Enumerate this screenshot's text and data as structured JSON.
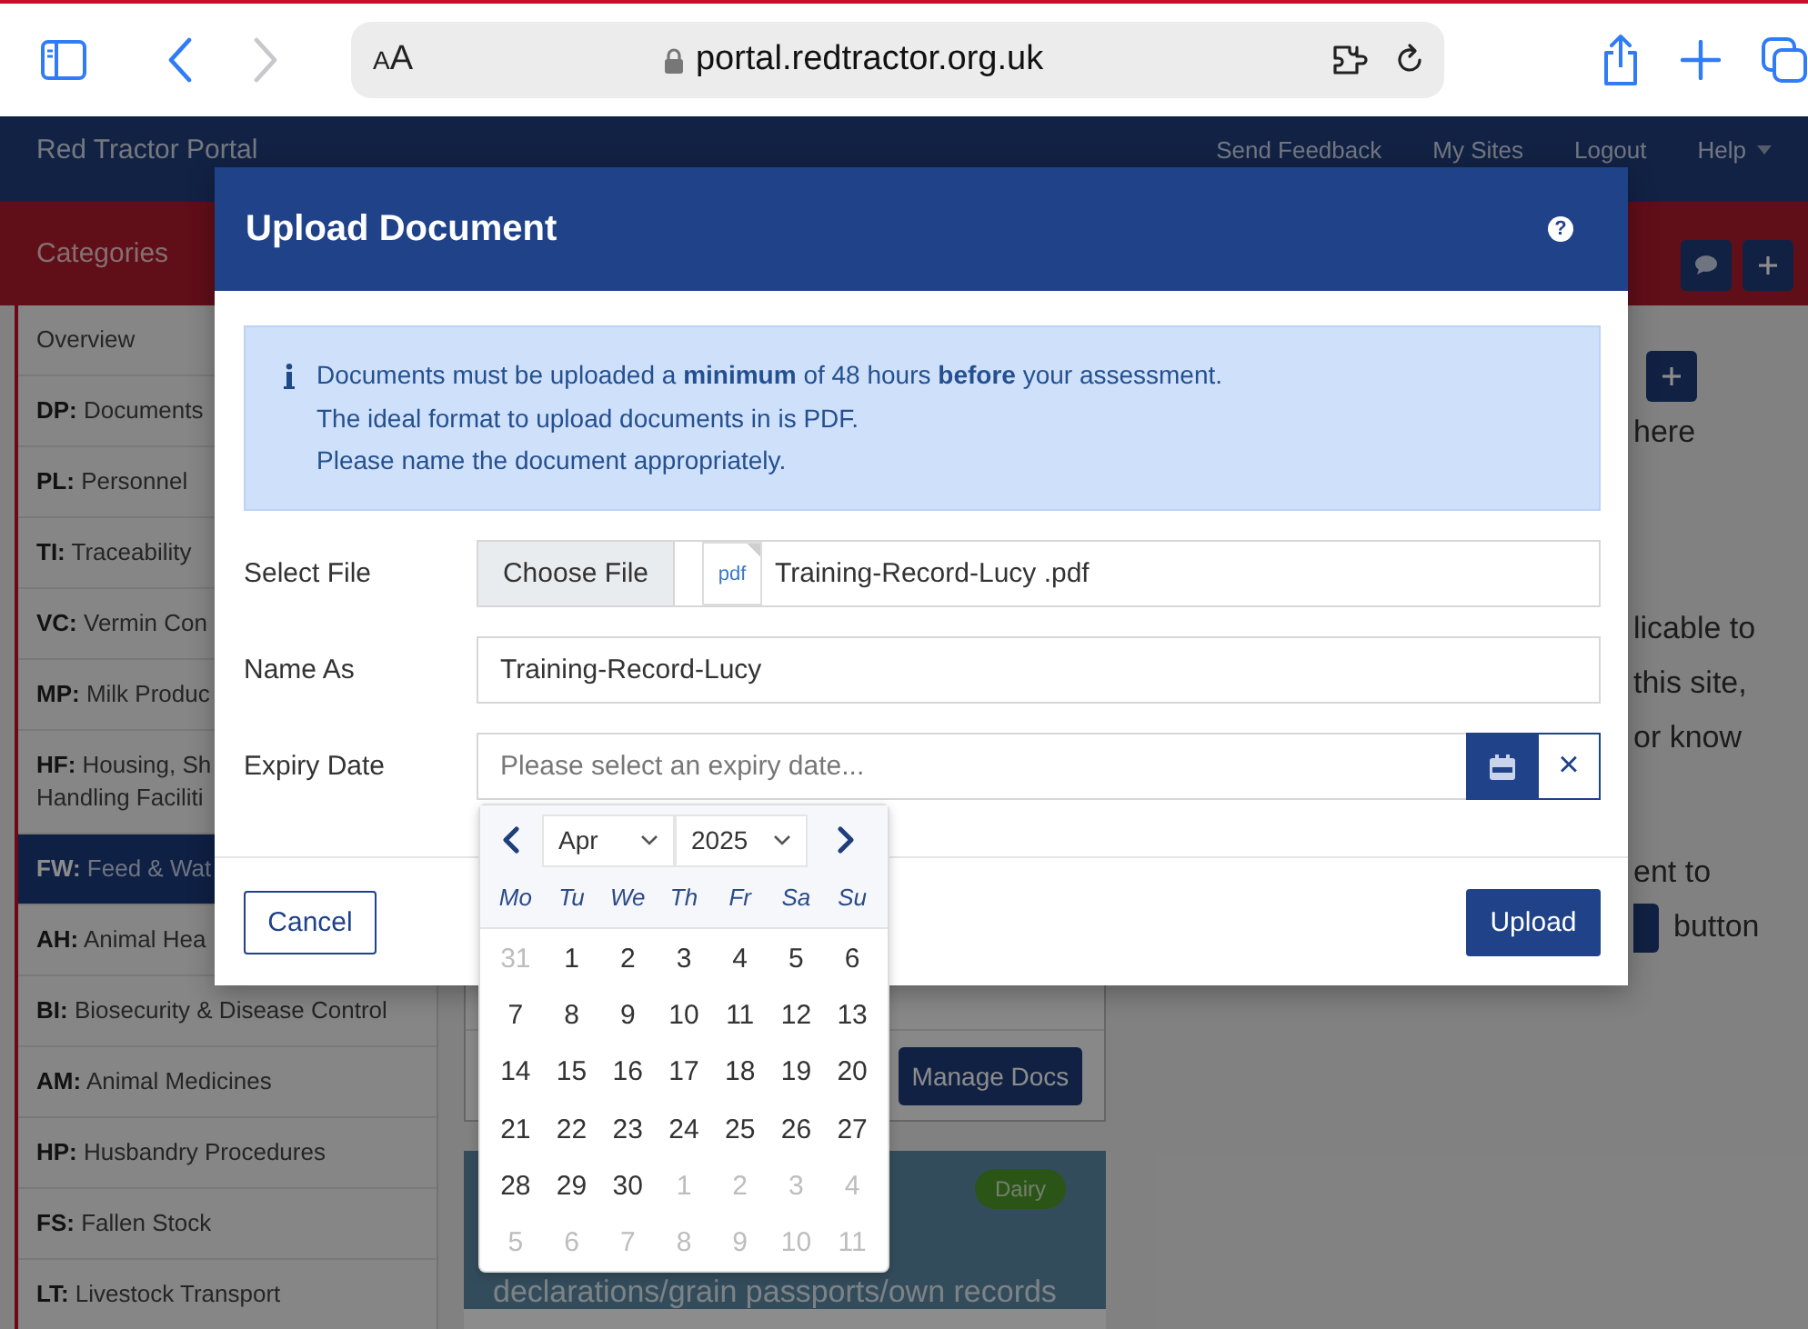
{
  "browser": {
    "text_size": "AA",
    "address": "portal.redtractor.org.uk",
    "back_disabled": false,
    "forward_disabled": true
  },
  "navbar": {
    "brand": "Red Tractor Portal",
    "links": [
      "Send Feedback",
      "My Sites",
      "Logout"
    ],
    "help": "Help"
  },
  "category_bar": {
    "title": "Categories"
  },
  "sidebar": {
    "items": [
      {
        "label": "Overview",
        "selected": false
      },
      {
        "label": "**DP:** Documents",
        "selected": false
      },
      {
        "label": "**PL:** Personnel",
        "selected": false
      },
      {
        "label": "**TI:** Traceability",
        "selected": false
      },
      {
        "label": "**VC:** Vermin Con",
        "selected": false
      },
      {
        "label": "**MP:** Milk Produc",
        "selected": false
      },
      {
        "label": "**HF:** Housing, Sh\nHandling Faciliti",
        "selected": false
      },
      {
        "label": "**FW:** Feed & Wat",
        "selected": true
      },
      {
        "label": "**AH:** Animal Hea",
        "selected": false
      },
      {
        "label": "**BI:** Biosecurity & Disease Control",
        "selected": false
      },
      {
        "label": "**AM:** Animal Medicines",
        "selected": false
      },
      {
        "label": "**HP:** Husbandry Procedures",
        "selected": false
      },
      {
        "label": "**FS:** Fallen Stock",
        "selected": false
      },
      {
        "label": "**LT:** Livestock Transport",
        "selected": false
      }
    ]
  },
  "background": {
    "right_top": "here",
    "right_middle": [
      "licable to",
      "this site,",
      "or know"
    ],
    "right_bottom": [
      "ent to",
      "button"
    ],
    "manage_button": "Manage Docs",
    "tag": "Dairy",
    "card_text": "declarations/grain passports/own records"
  },
  "modal": {
    "title": "Upload Document",
    "help": "?",
    "notice": [
      "Documents must be uploaded a **minimum** of 48 hours **before** your assessment.",
      "The ideal format to upload documents in is PDF.",
      "Please name the document appropriately."
    ],
    "fields": [
      {
        "kind": "file",
        "label": "Select File",
        "button": "Choose File",
        "file_type": "pdf",
        "value": "Training-Record-Lucy .pdf"
      },
      {
        "kind": "text",
        "label": "Name As",
        "value": "Training-Record-Lucy"
      },
      {
        "kind": "date",
        "label": "Expiry Date",
        "placeholder": "Please select an expiry date...",
        "clear": "×"
      }
    ],
    "cancel": "Cancel",
    "submit": "Upload"
  },
  "datepicker": {
    "month": "Apr",
    "year": "2025",
    "weekdays": [
      "Mo",
      "Tu",
      "We",
      "Th",
      "Fr",
      "Sa",
      "Su"
    ],
    "weeks": [
      [
        {
          "day": "31",
          "muted": true
        },
        {
          "day": "1",
          "muted": false
        },
        {
          "day": "2",
          "muted": false
        },
        {
          "day": "3",
          "muted": false
        },
        {
          "day": "4",
          "muted": false
        },
        {
          "day": "5",
          "muted": false
        },
        {
          "day": "6",
          "muted": false
        }
      ],
      [
        {
          "day": "7",
          "muted": false
        },
        {
          "day": "8",
          "muted": false
        },
        {
          "day": "9",
          "muted": false
        },
        {
          "day": "10",
          "muted": false
        },
        {
          "day": "11",
          "muted": false
        },
        {
          "day": "12",
          "muted": false
        },
        {
          "day": "13",
          "muted": false
        }
      ],
      [
        {
          "day": "14",
          "muted": false
        },
        {
          "day": "15",
          "muted": false
        },
        {
          "day": "16",
          "muted": false
        },
        {
          "day": "17",
          "muted": false
        },
        {
          "day": "18",
          "muted": false
        },
        {
          "day": "19",
          "muted": false
        },
        {
          "day": "20",
          "muted": false
        }
      ],
      [
        {
          "day": "21",
          "muted": false
        },
        {
          "day": "22",
          "muted": false
        },
        {
          "day": "23",
          "muted": false
        },
        {
          "day": "24",
          "muted": false
        },
        {
          "day": "25",
          "muted": false
        },
        {
          "day": "26",
          "muted": false
        },
        {
          "day": "27",
          "muted": false
        }
      ],
      [
        {
          "day": "28",
          "muted": false
        },
        {
          "day": "29",
          "muted": false
        },
        {
          "day": "30",
          "muted": false
        },
        {
          "day": "1",
          "muted": true
        },
        {
          "day": "2",
          "muted": true
        },
        {
          "day": "3",
          "muted": true
        },
        {
          "day": "4",
          "muted": true
        }
      ],
      [
        {
          "day": "5",
          "muted": true
        },
        {
          "day": "6",
          "muted": true
        },
        {
          "day": "7",
          "muted": true
        },
        {
          "day": "8",
          "muted": true
        },
        {
          "day": "9",
          "muted": true
        },
        {
          "day": "10",
          "muted": true
        },
        {
          "day": "11",
          "muted": true
        }
      ]
    ]
  }
}
